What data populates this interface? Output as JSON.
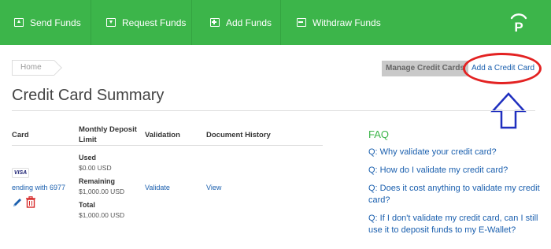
{
  "nav": {
    "items": [
      {
        "label": "Send Funds",
        "icon": "send-funds-icon"
      },
      {
        "label": "Request Funds",
        "icon": "request-funds-icon"
      },
      {
        "label": "Add Funds",
        "icon": "add-funds-icon"
      },
      {
        "label": "Withdraw Funds",
        "icon": "withdraw-funds-icon"
      }
    ],
    "logo_letter": "P"
  },
  "breadcrumb": {
    "home": "Home"
  },
  "actions": {
    "manage": "Manage Credit Cards",
    "add": "Add a Credit Card"
  },
  "page_title": "Credit Card Summary",
  "table": {
    "headers": {
      "card": "Card",
      "monthly_line1": "Monthly Deposit",
      "monthly_line2": "Limit",
      "validation": "Validation",
      "history": "Document History"
    },
    "row": {
      "brand": "VISA",
      "ending": "ending with 6977",
      "used_label": "Used",
      "used_value": "$0.00 USD",
      "remaining_label": "Remaining",
      "remaining_value": "$1,000.00 USD",
      "total_label": "Total",
      "total_value": "$1,000.00 USD",
      "validate": "Validate",
      "view": "View"
    }
  },
  "faq": {
    "title": "FAQ",
    "q1": "Q: Why validate your credit card?",
    "q2": "Q: How do I validate my credit card?",
    "q3": "Q: Does it cost anything to validate my credit card?",
    "q4": "Q: If I don't validate my credit card, can I still use it to deposit funds to my E-Wallet?"
  },
  "colors": {
    "brand_green": "#3cb54a",
    "link_blue": "#1a5fae",
    "highlight_red": "#e32222",
    "arrow_blue": "#1f2fbf"
  }
}
